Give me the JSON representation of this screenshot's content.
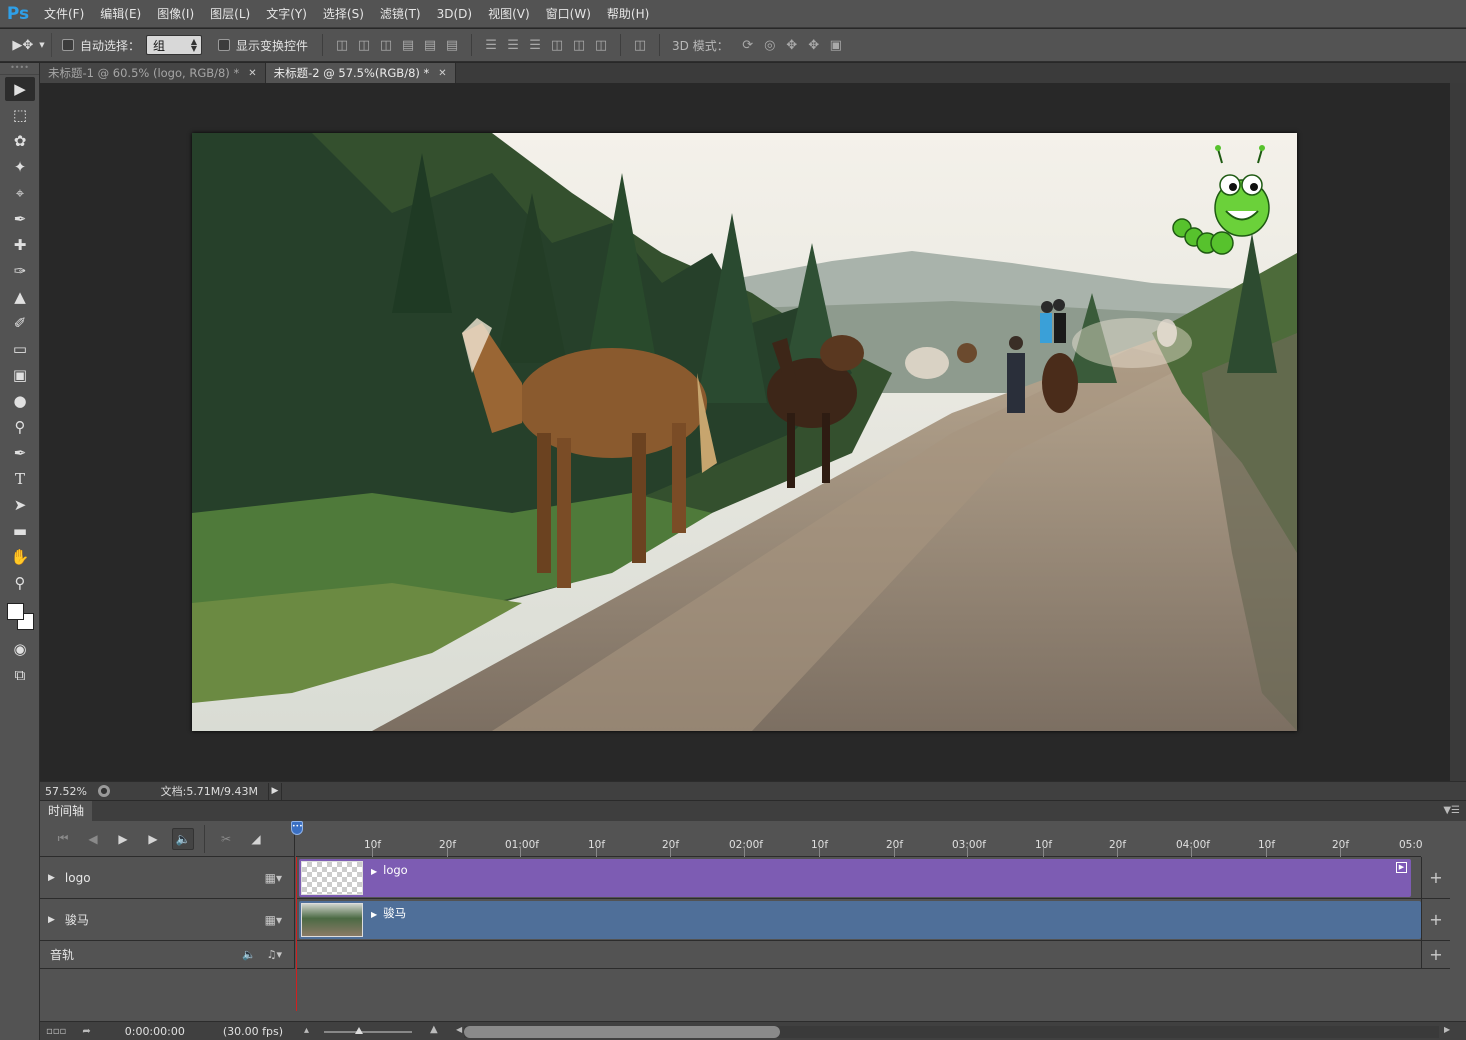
{
  "app": {
    "logo": "Ps"
  },
  "menu": [
    "文件(F)",
    "编辑(E)",
    "图像(I)",
    "图层(L)",
    "文字(Y)",
    "选择(S)",
    "滤镜(T)",
    "3D(D)",
    "视图(V)",
    "窗口(W)",
    "帮助(H)"
  ],
  "options_bar": {
    "auto_select_label": "自动选择：",
    "auto_select_value": "组",
    "show_transform_label": "显示变换控件",
    "mode_3d_label": "3D 模式："
  },
  "tabs": [
    {
      "label": "未标题-1 @ 60.5% (logo, RGB/8) *",
      "active": false
    },
    {
      "label": "未标题-2 @ 57.5%(RGB/8) *",
      "active": true
    }
  ],
  "tools": [
    "move-tool-icon",
    "marquee-tool-icon",
    "lasso-tool-icon",
    "magic-wand-icon",
    "crop-tool-icon",
    "eyedropper-icon",
    "healing-brush-icon",
    "brush-tool-icon",
    "clone-stamp-icon",
    "history-brush-icon",
    "eraser-icon",
    "gradient-icon",
    "blur-icon",
    "dodge-icon",
    "pen-tool-icon",
    "type-tool-icon",
    "path-select-icon",
    "rectangle-tool-icon",
    "hand-tool-icon",
    "zoom-tool-icon"
  ],
  "colors": {
    "foreground": "#ffffff",
    "background": "#ffffff",
    "logo_clip": "#7d5cb3",
    "video_clip": "#4f6f99",
    "playhead": "#d02020"
  },
  "status": {
    "zoom": "57.52%",
    "doc_info": "文档:5.71M/9.43M"
  },
  "timeline": {
    "title": "时间轴",
    "ruler_labels": [
      "10f",
      "20f",
      "01:00f",
      "10f",
      "20f",
      "02:00f",
      "10f",
      "20f",
      "03:00f",
      "10f",
      "20f",
      "04:00f",
      "10f",
      "20f",
      "05:0"
    ],
    "tracks": [
      {
        "name": "logo",
        "clip_label": "logo"
      },
      {
        "name": "骏马",
        "clip_label": "骏马"
      }
    ],
    "audio_track": "音轨",
    "timecode": "0:00:00:00",
    "fps": "(30.00 fps)"
  }
}
